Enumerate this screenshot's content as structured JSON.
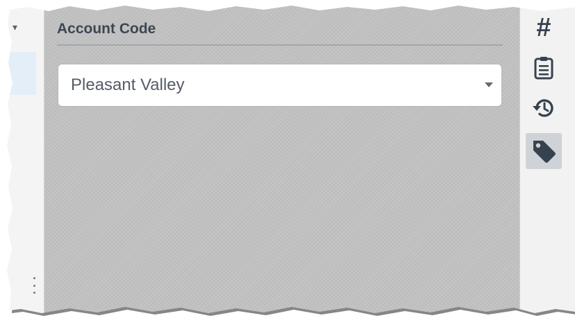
{
  "section": {
    "title": "Account Code"
  },
  "account_select": {
    "value": "Pleasant Valley",
    "caret_icon": "chevron-down-icon"
  },
  "right_rail": {
    "buttons": [
      {
        "icon": "hash-icon",
        "glyph": "#",
        "active": false
      },
      {
        "icon": "clipboard-list-icon",
        "active": false
      },
      {
        "icon": "history-icon",
        "active": false
      },
      {
        "icon": "tag-icon",
        "active": true
      }
    ]
  },
  "colors": {
    "panel_bg": "#c2c2c2",
    "title_text": "#3d4752",
    "icon_color": "#37424f",
    "active_btn_bg": "#cfd3d7",
    "selected_row_bg": "#e3eef9"
  }
}
